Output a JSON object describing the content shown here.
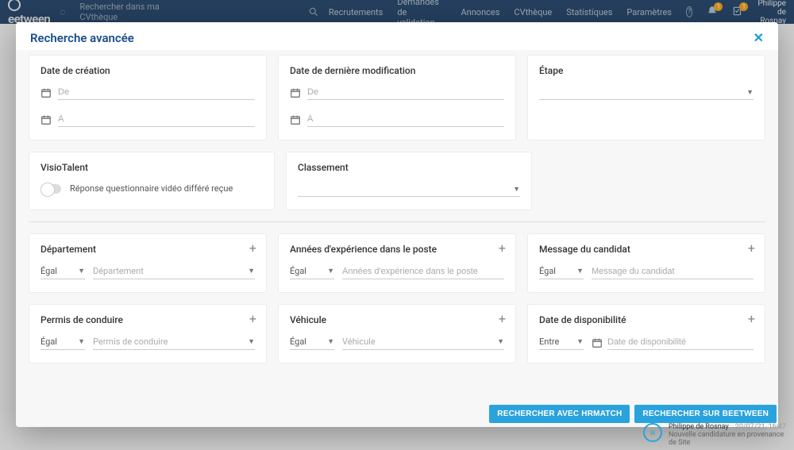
{
  "topbar": {
    "logo": "eetween",
    "search_placeholder": "Rechercher dans ma CVthèque",
    "nav": {
      "recrutements": "Recrutements",
      "demandes": "Demandes de validation",
      "annonces": "Annonces",
      "cvtheque": "CVthèque",
      "statistiques": "Statistiques",
      "parametres": "Paramètres"
    },
    "badge1": "1",
    "badge2": "1",
    "user_line1": "Philippe",
    "user_line2": "de Rosnay"
  },
  "modal": {
    "title": "Recherche avancée",
    "cards": {
      "creation": {
        "title": "Date de création",
        "from": "De",
        "to": "À"
      },
      "modification": {
        "title": "Date de dernière modification",
        "from": "De",
        "to": "À"
      },
      "etape": {
        "title": "Étape"
      },
      "visiotalent": {
        "title": "VisioTalent",
        "switch_label": "Réponse questionnaire vidéo différé reçue"
      },
      "classement": {
        "title": "Classement"
      },
      "departement": {
        "title": "Département",
        "op": "Égal",
        "placeholder": "Département"
      },
      "experience": {
        "title": "Années d'expérience dans le poste",
        "op": "Égal",
        "placeholder": "Années d'expérience dans le poste"
      },
      "message": {
        "title": "Message du candidat",
        "op": "Égal",
        "placeholder": "Message du candidat"
      },
      "permis": {
        "title": "Permis de conduire",
        "op": "Égal",
        "placeholder": "Permis de conduire"
      },
      "vehicule": {
        "title": "Véhicule",
        "op": "Égal",
        "placeholder": "Véhicule"
      },
      "dispo": {
        "title": "Date de disponibilité",
        "op": "Entre",
        "placeholder": "Date de disponibilité"
      }
    },
    "buttons": {
      "hrmatch": "RECHERCHER AVEC HRMATCH",
      "beetween": "RECHERCHER SUR BEETWEEN"
    }
  },
  "notif": {
    "name": "Philippe de Rosnay",
    "timestamp": "20/07/21, 16:47",
    "text": "Nouvelle candidature en provenance de Site"
  }
}
